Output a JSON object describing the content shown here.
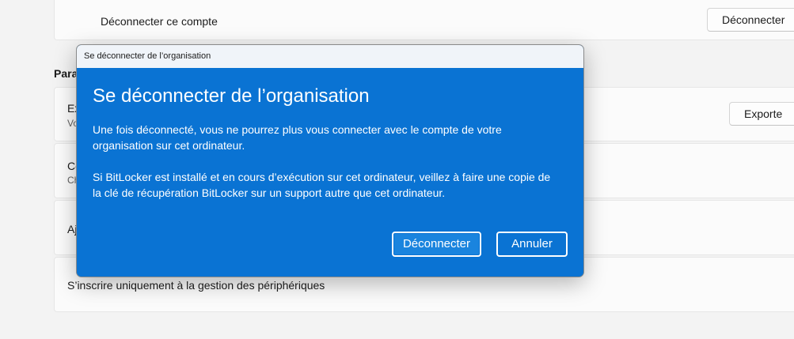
{
  "background": {
    "top_card": {
      "title": "Déconnecter ce compte",
      "button_label": "Déconnecter"
    },
    "section_heading": "Para",
    "cards": [
      {
        "title": "Ex",
        "subtitle": "Vo",
        "button_label": "Exporte"
      },
      {
        "title": "Co",
        "subtitle": "Ch"
      },
      {
        "title": "Aj"
      },
      {
        "title": "S’inscrire uniquement à la gestion des périphériques"
      }
    ]
  },
  "dialog": {
    "window_title": "Se déconnecter de l’organisation",
    "heading": "Se déconnecter de l’organisation",
    "paragraph1": "Une fois déconnecté, vous ne pourrez plus vous connecter avec le compte de votre organisation sur cet ordinateur.",
    "paragraph2": "Si BitLocker est installé et en cours d’exécution sur cet ordinateur, veillez à faire une copie de la clé de récupération BitLocker sur un support autre que cet ordinateur.",
    "confirm_label": "Déconnecter",
    "cancel_label": "Annuler"
  },
  "colors": {
    "dialog_accent": "#0078d4",
    "page_background": "#f3f3f3"
  }
}
